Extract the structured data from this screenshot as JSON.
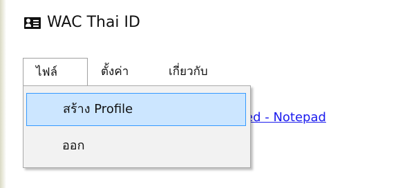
{
  "window": {
    "title": "WAC Thai ID",
    "icon": "id-card-icon"
  },
  "menubar": {
    "items": [
      {
        "label": "ไฟล์"
      },
      {
        "label": "ตั้งค่า"
      },
      {
        "label": "เกี่ยวกับ"
      }
    ]
  },
  "file_menu": {
    "items": [
      {
        "label": "สร้าง Profile",
        "state": "highlighted"
      },
      {
        "label": "ออก"
      }
    ]
  },
  "content": {
    "link_text": "led - Notepad"
  },
  "colors": {
    "highlight_bg": "#cce6ff",
    "highlight_border": "#3399ff",
    "link": "#1a1aee"
  }
}
